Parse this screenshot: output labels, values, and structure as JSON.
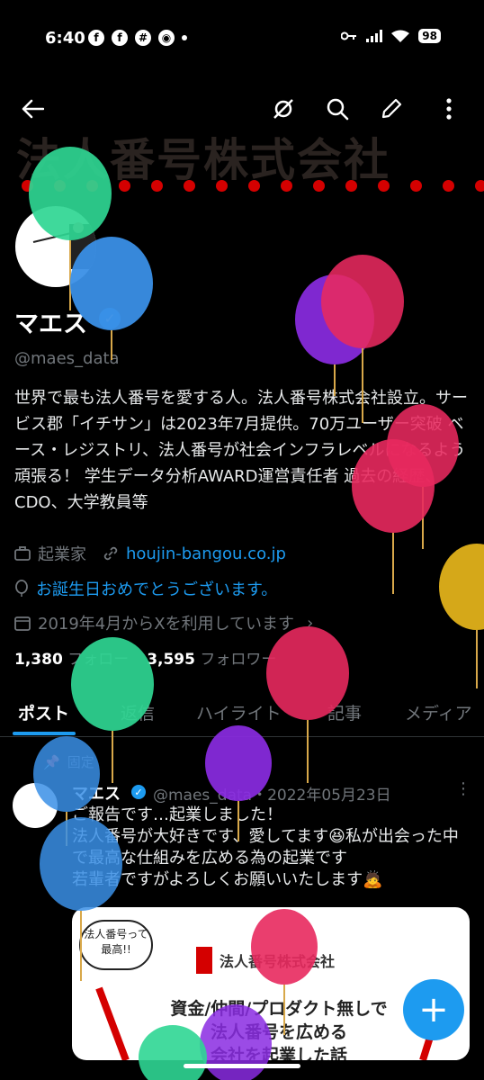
{
  "status_bar": {
    "time": "6:40",
    "battery": "98"
  },
  "banner": {
    "title": "法人番号株式会社"
  },
  "profile": {
    "name": "マエス",
    "handle": "@maes_data",
    "bio": "世界で最も法人番号を愛する人。法人番号株式会社設立。サービス郡「イチサン」は2023年7月提供。70万ユーザー突破 ベース・レジストリ、法人番号が社会インフラレベルになるよう頑張る！ 学生データ分析AWARD運営責任者 過去の経歴、CDO、大学教員等",
    "job": "起業家",
    "website": "houjin-bangou.co.jp",
    "birthday": "お誕生日おめでとうございます。",
    "joined": "2019年4月からXを利用しています",
    "following_count": "1,380",
    "following_label": "フォロー",
    "followers_count": "3,595",
    "followers_label": "フォロワー"
  },
  "tabs": [
    {
      "label": "ポスト"
    },
    {
      "label": "返信"
    },
    {
      "label": "ハイライト"
    },
    {
      "label": "記事"
    },
    {
      "label": "メディア"
    }
  ],
  "pinned_post": {
    "pinned_label": "固定",
    "name": "マエス",
    "handle_date": "@maes_data・2022年05月23日",
    "text": "ご報告です…起業しました！\n法人番号が大好きです、愛してます😆私が出会った中で最高な仕組みを広める為の起業です\n若輩者ですがよろしくお願いいたします🙇",
    "card": {
      "bubble_text": "法人番号って最高!!",
      "brand": "法人番号株式会社",
      "headline_1": "資金/仲間/プロダクト無しで",
      "headline_2": "法人番号を広める",
      "headline_3": "会社を起業した話"
    }
  },
  "fab": {
    "label": "+"
  },
  "colors": {
    "accent": "#1d9bf0",
    "background": "#000000",
    "brand_red": "#d40000"
  }
}
